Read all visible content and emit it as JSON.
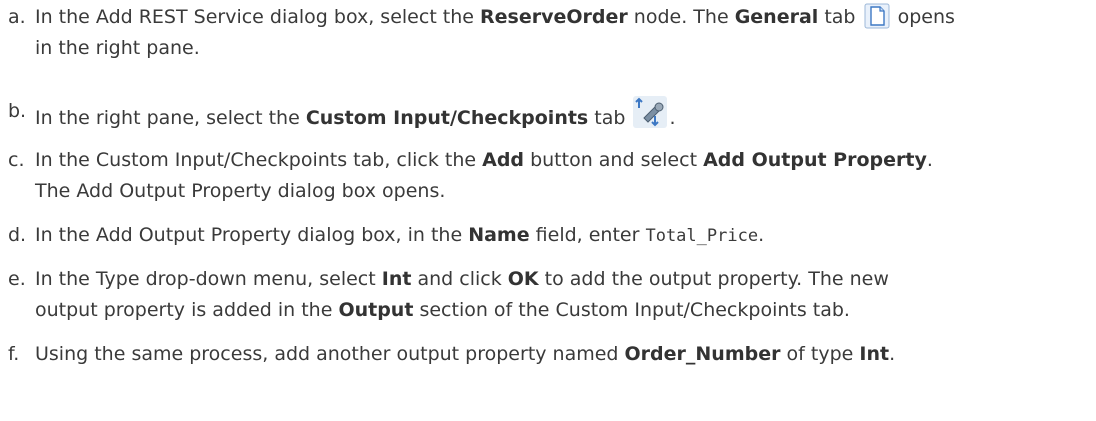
{
  "steps": [
    {
      "marker": "a.",
      "t1": "In the Add REST Service dialog box, select the ",
      "b1": "ReserveOrder",
      "t2": " node. The ",
      "b2": "General",
      "t3": " tab ",
      "t4": " opens",
      "line2": "in the right pane.",
      "icon": "document-icon"
    },
    {
      "marker": "b.",
      "t1": "In the right pane, select the ",
      "b1": "Custom Input/Checkpoints",
      "t2": " tab ",
      "t3": ".",
      "icon": "custom-input-checkpoints-icon"
    },
    {
      "marker": "c.",
      "t1": "In the Custom Input/Checkpoints tab, click the ",
      "b1": "Add",
      "t2": " button and select ",
      "b2": "Add Output Property",
      "t3": ".",
      "line2": "The Add Output Property dialog box opens."
    },
    {
      "marker": "d.",
      "t1": "In the Add Output Property dialog box, in the ",
      "b1": "Name",
      "t2": " field, enter ",
      "code": "Total_Price",
      "t3": "."
    },
    {
      "marker": "e.",
      "t1": "In the Type drop-down menu, select ",
      "b1": "Int",
      "t2": " and click ",
      "b2": "OK",
      "t3": " to add the output property. The new",
      "line2a": "output property is added in the ",
      "line2b": "Output",
      "line2c": " section of the Custom Input/Checkpoints tab."
    },
    {
      "marker": "f.",
      "t1": "Using the same process, add another output property named ",
      "b1": "Order_Number",
      "t2": " of type ",
      "b2": "Int",
      "t3": "."
    }
  ]
}
